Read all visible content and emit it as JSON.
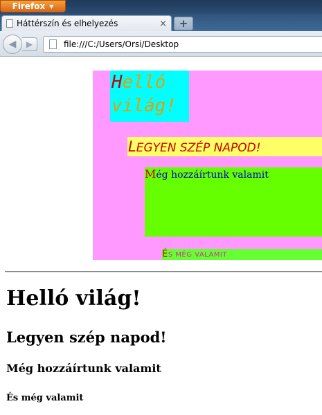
{
  "browser": {
    "app_button": "Firefox",
    "tab_title": "Háttérszín és elhelyezés",
    "tab_close": "×",
    "new_tab": "+",
    "url": "file:///C:/Users/Orsi/Desktop"
  },
  "styled": {
    "box1_first": "H",
    "box1_rest": "elló világ!",
    "box2_first": "L",
    "box2_rest": "EGYEN SZÉP NAPOD!",
    "box3_first": "M",
    "box3_rest": "ég hozzáírtunk valamit",
    "box4_first": "É",
    "box4_rest": "S MÉG VALAMIT"
  },
  "headings": {
    "h1": "Helló világ!",
    "h2": "Legyen szép napod!",
    "h3": "Még hozzáírtunk valamit",
    "h4": "És még valamit"
  },
  "colors": {
    "pink_bg": "#ff99ff",
    "cyan_bg": "#00ffff",
    "yellow_bg": "#ffff66",
    "green_bg": "#66ff00",
    "first_letter_red": "#cc0000"
  }
}
